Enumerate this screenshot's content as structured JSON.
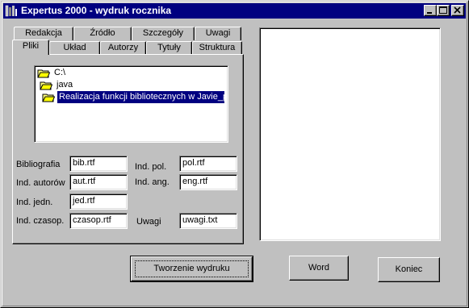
{
  "window": {
    "title": "Expertus 2000 - wydruk rocznika"
  },
  "tabs": {
    "row_back": [
      "Redakcja",
      "Źródło",
      "Szczegóły",
      "Uwagi"
    ],
    "row_front": [
      "Pliki",
      "Układ",
      "Autorzy",
      "Tytuły",
      "Struktura"
    ],
    "active": "Pliki"
  },
  "file_list": {
    "items": [
      "C:\\",
      "java",
      "Realizacja funkcji bibliotecznych w Javie_pl"
    ],
    "selected_index": 2
  },
  "fields": {
    "bibliografia": {
      "label": "Bibliografia",
      "value": "bib.rtf"
    },
    "ind_autorow": {
      "label": "Ind. autorów",
      "value": "aut.rtf"
    },
    "ind_jedn": {
      "label": "Ind. jedn.",
      "value": "jed.rtf"
    },
    "ind_czasop": {
      "label": "Ind. czasop.",
      "value": "czasop.rtf"
    },
    "ind_pol": {
      "label": "Ind. pol.",
      "value": "pol.rtf"
    },
    "ind_ang": {
      "label": "Ind. ang.",
      "value": "eng.rtf"
    },
    "uwagi": {
      "label": "Uwagi",
      "value": "uwagi.txt"
    }
  },
  "buttons": {
    "generate": "Tworzenie wydruku",
    "word": "Word",
    "close": "Koniec"
  },
  "icons": [
    "app-icon",
    "folder-open-icon",
    "minimize-icon",
    "maximize-icon",
    "close-icon"
  ],
  "colors": {
    "titlebar": "#000080",
    "selection": "#000080",
    "face": "#c0c0c0"
  }
}
